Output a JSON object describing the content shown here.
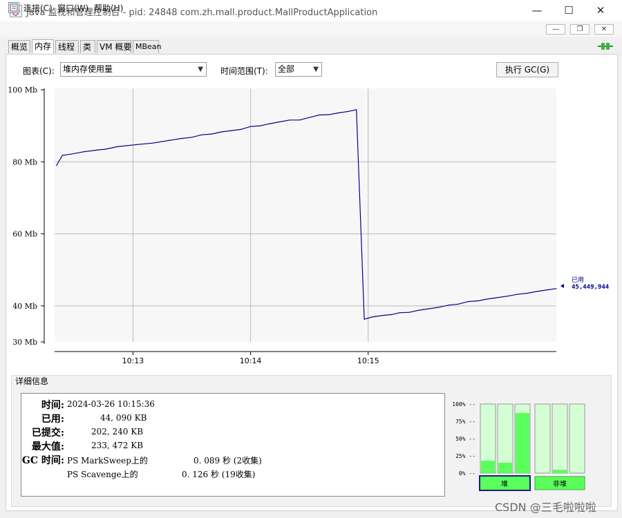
{
  "window": {
    "title": "Java 监视和管理控制台 - pid: 24848 com.zh.mall.product.MallProductApplication",
    "minimize": "—",
    "maximize": "☐",
    "close": "✕",
    "app_icon": "java-cup-icon"
  },
  "menubar": {
    "doc_icon": "document-icon",
    "items": [
      "连接(C)",
      "窗口(W)",
      "帮助(H)"
    ],
    "mdi_minimize": "—",
    "mdi_restore": "❐",
    "mdi_close": "✕"
  },
  "tabs": [
    "概览",
    "内存",
    "线程",
    "类",
    "VM 概要",
    "MBean"
  ],
  "active_tab": "内存",
  "connection_icon": "connected-plug-icon",
  "controls": {
    "chart_label": "图表(C):",
    "chart_value": "堆内存使用量",
    "range_label": "时间范围(T):",
    "range_value": "全部",
    "gc_button": "执行 GC(G)"
  },
  "chart_data": {
    "type": "line",
    "series": [
      {
        "name": "已用",
        "color": "#00008b",
        "latest_label": "45,449,944",
        "points": [
          [
            "10:12:21",
            79
          ],
          [
            "10:12:24",
            81.8
          ],
          [
            "10:12:28",
            82.1
          ],
          [
            "10:12:35",
            82.8
          ],
          [
            "10:12:42",
            83.3
          ],
          [
            "10:12:46",
            83.5
          ],
          [
            "10:12:52",
            84.2
          ],
          [
            "10:13:02",
            84.8
          ],
          [
            "10:13:10",
            85.2
          ],
          [
            "10:13:18",
            85.9
          ],
          [
            "10:13:25",
            86.5
          ],
          [
            "10:13:30",
            86.8
          ],
          [
            "10:13:35",
            87.5
          ],
          [
            "10:13:40",
            87.7
          ],
          [
            "10:13:45",
            88.3
          ],
          [
            "10:13:55",
            89.0
          ],
          [
            "10:14:00",
            89.8
          ],
          [
            "10:14:05",
            90.0
          ],
          [
            "10:14:10",
            90.6
          ],
          [
            "10:14:15",
            91.1
          ],
          [
            "10:14:20",
            91.6
          ],
          [
            "10:14:25",
            91.6
          ],
          [
            "10:14:30",
            92.3
          ],
          [
            "10:14:35",
            93.0
          ],
          [
            "10:14:40",
            93.1
          ],
          [
            "10:14:45",
            93.6
          ],
          [
            "10:14:50",
            94.0
          ],
          [
            "10:14:54",
            94.5
          ],
          [
            "10:14:58",
            36.3
          ],
          [
            "10:15:02",
            36.9
          ],
          [
            "10:15:07",
            37.3
          ],
          [
            "10:15:12",
            37.6
          ],
          [
            "10:15:16",
            38.1
          ],
          [
            "10:15:21",
            38.2
          ],
          [
            "10:15:26",
            38.8
          ],
          [
            "10:15:31",
            39.2
          ],
          [
            "10:15:36",
            39.6
          ],
          [
            "10:15:41",
            40.2
          ],
          [
            "10:15:46",
            40.5
          ],
          [
            "10:15:51",
            41.2
          ],
          [
            "10:15:56",
            41.4
          ],
          [
            "10:16:01",
            41.9
          ],
          [
            "10:16:06",
            42.3
          ],
          [
            "10:16:11",
            42.7
          ],
          [
            "10:16:16",
            43.2
          ],
          [
            "10:16:21",
            43.5
          ],
          [
            "10:16:26",
            44.0
          ],
          [
            "10:16:31",
            44.4
          ],
          [
            "10:16:36",
            44.8
          ]
        ]
      }
    ],
    "y_ticks": [
      "100 Mb",
      "80 Mb",
      "60 Mb",
      "40 Mb",
      "30 Mb"
    ],
    "x_ticks": [
      "10:13",
      "10:14",
      "10:15"
    ],
    "ylim": [
      30,
      100
    ],
    "grid": true
  },
  "details": {
    "title": "详细信息",
    "time_label": "时间:",
    "time_value": "2024-03-26 10:15:36",
    "used_label": "已用:",
    "used_value": "44, 090 KB",
    "committed_label": "已提交:",
    "committed_value": "202, 240 KB",
    "max_label": "最大值:",
    "max_value": "233, 472 KB",
    "gc_label": "GC 时间:",
    "gc_rows": [
      {
        "name": "PS MarkSweep上的",
        "value": "0. 089 秒 (2收集)"
      },
      {
        "name": "PS Scavenge上的",
        "value": "0. 126 秒 (19收集)"
      }
    ]
  },
  "pool_bars": {
    "ticks": [
      "100% --",
      "75% --",
      "50% --",
      "25% --",
      "0% --"
    ],
    "heap_label": "堆",
    "nonheap_label": "非堆",
    "heap_levels": [
      0.18,
      0.15,
      0.87
    ],
    "nonheap_levels": [
      0,
      0.05,
      0
    ],
    "fill_color": "#5bff5b",
    "empty_color": "#d4ffd4"
  },
  "watermark": "CSDN @三毛啦啦啦"
}
